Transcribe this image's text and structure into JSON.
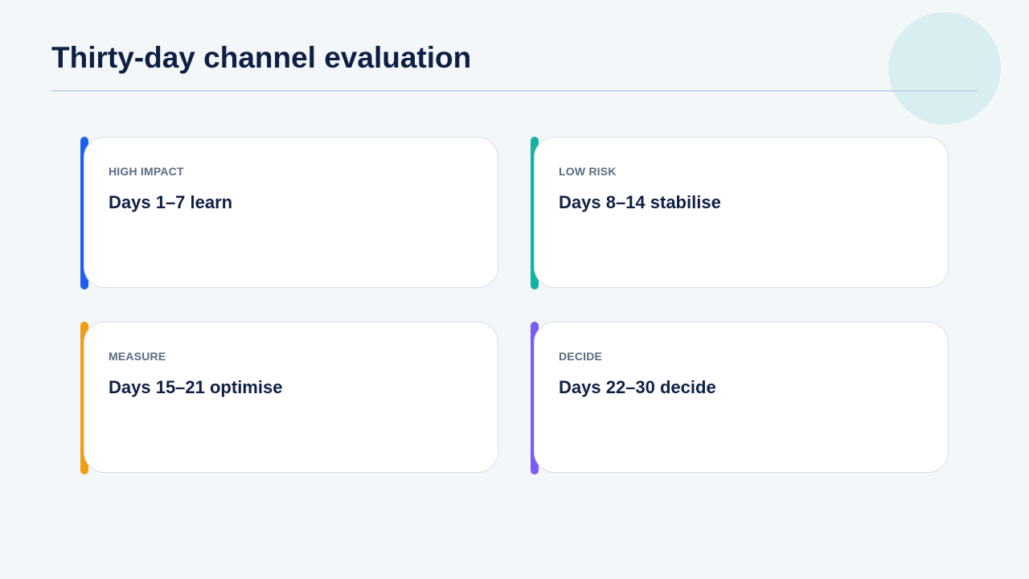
{
  "title": "Thirty-day channel evaluation",
  "cards": [
    {
      "label": "HIGH IMPACT",
      "heading": "Days 1–7 learn",
      "accent_color": "#1f5ff0"
    },
    {
      "label": "LOW RISK",
      "heading": "Days 8–14 stabilise",
      "accent_color": "#14b3a1"
    },
    {
      "label": "MEASURE",
      "heading": "Days 15–21 optimise",
      "accent_color": "#f29d12"
    },
    {
      "label": "DECIDE",
      "heading": "Days 22–30 decide",
      "accent_color": "#7b5cf2"
    }
  ],
  "colors": {
    "background": "#f3f7fa",
    "title": "#0f1f44",
    "decor_circle": "#d8eef0"
  }
}
